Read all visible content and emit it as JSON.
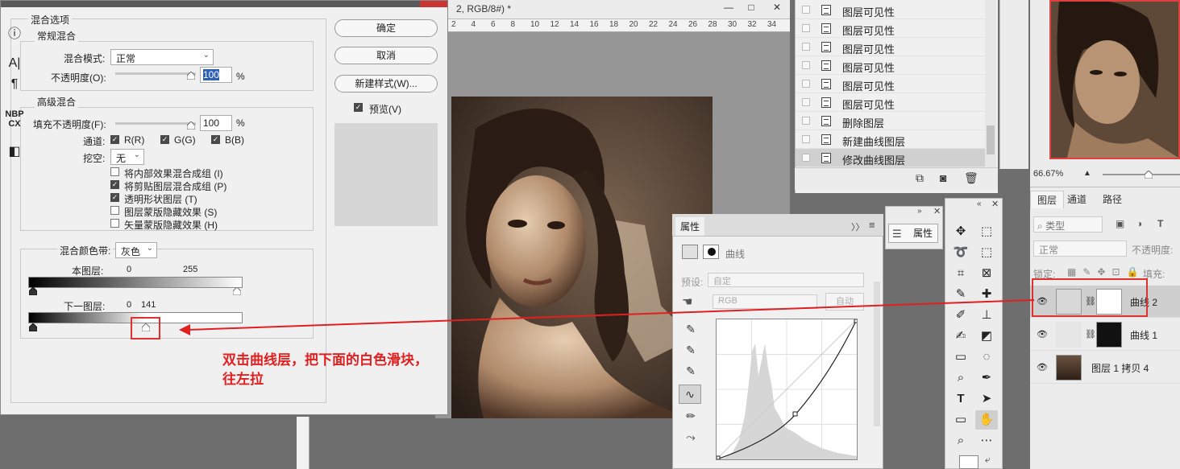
{
  "document": {
    "tab_title": "2, RGB/8#) *",
    "ruler_numbers": [
      "2",
      "4",
      "6",
      "8",
      "10",
      "12",
      "14",
      "16",
      "18",
      "20",
      "22",
      "24",
      "26",
      "28",
      "30",
      "32",
      "34"
    ],
    "window_controls": [
      "—",
      "□",
      "✕"
    ]
  },
  "blend_dialog": {
    "title": "混合选项",
    "general_blend": {
      "title": "常规混合",
      "mode_label": "混合模式:",
      "mode_value": "正常",
      "opacity_label": "不透明度(O):",
      "opacity_value": "100",
      "opacity_unit": "%"
    },
    "advanced_blend": {
      "title": "高级混合",
      "fill_opacity_label": "填充不透明度(F):",
      "fill_opacity_value": "100",
      "fill_opacity_unit": "%",
      "channels_label": "通道:",
      "channel_r": "R(R)",
      "channel_g": "G(G)",
      "channel_b": "B(B)",
      "knockout_label": "挖空:",
      "knockout_value": "无",
      "options": [
        {
          "label": "将内部效果混合成组 (I)",
          "checked": false
        },
        {
          "label": "将剪贴图层混合成组 (P)",
          "checked": true
        },
        {
          "label": "透明形状图层 (T)",
          "checked": true
        },
        {
          "label": "图层蒙版隐藏效果 (S)",
          "checked": false
        },
        {
          "label": "矢量蒙版隐藏效果 (H)",
          "checked": false
        }
      ]
    },
    "blend_if": {
      "label": "混合颜色带:",
      "value": "灰色",
      "this_layer_label": "本图层:",
      "this_layer_min": "0",
      "this_layer_max": "255",
      "underlying_label": "下一图层:",
      "underlying_min": "0",
      "underlying_max": "141"
    },
    "buttons": {
      "ok": "确定",
      "cancel": "取消",
      "new_style": "新建样式(W)...",
      "preview": "预览(V)"
    }
  },
  "annotation": {
    "line1": "双击曲线层，把下面的白色滑块，",
    "line2": "往左拉",
    "color": "#e02020"
  },
  "history": {
    "items": [
      {
        "label": "图层可见性",
        "active": false
      },
      {
        "label": "图层可见性",
        "active": false
      },
      {
        "label": "图层可见性",
        "active": false
      },
      {
        "label": "图层可见性",
        "active": false
      },
      {
        "label": "图层可见性",
        "active": false
      },
      {
        "label": "图层可见性",
        "active": false
      },
      {
        "label": "删除图层",
        "active": false
      },
      {
        "label": "新建曲线图层",
        "active": false
      },
      {
        "label": "修改曲线图层",
        "active": true
      }
    ]
  },
  "navigator": {
    "zoom": "66.67%"
  },
  "paragraph_toolbar": {
    "icons": [
      "info-icon",
      "character-icon",
      "paragraph-icon",
      "glyphs-icon",
      "panel-icon"
    ],
    "nbp_label": "NBP",
    "cx_label": "CX"
  },
  "layers": {
    "tabs": [
      "图层",
      "通道",
      "路径"
    ],
    "filter_label": "类型",
    "blend_mode": "正常",
    "opacity_label": "不透明度:",
    "lock_label": "锁定:",
    "fill_label": "填充:",
    "rows": [
      {
        "name": "曲线 2",
        "selected": true
      },
      {
        "name": "曲线 1",
        "selected": false
      },
      {
        "name": "图层 1 拷贝 4",
        "selected": false
      }
    ]
  },
  "properties": {
    "tab": "属性",
    "curves_label": "曲线",
    "preset_label": "预设:",
    "preset_value": "自定",
    "channel_value": "RGB",
    "auto_label": "自动"
  },
  "adjust_panel": {
    "button_label": "属性"
  }
}
